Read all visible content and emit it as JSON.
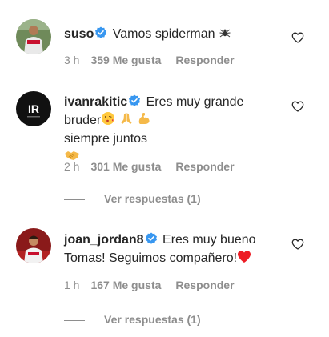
{
  "comments": [
    {
      "username": "suso",
      "text": "Vamos spiderman",
      "time": "3 h",
      "likes": "359 Me gusta",
      "reply": "Responder",
      "emoji": "spider-icon"
    },
    {
      "username": "ivanrakitic",
      "text": "Eres muy grande bruder",
      "text2": "siempre juntos",
      "time": "2 h",
      "likes": "301 Me gusta",
      "reply": "Responder",
      "view_replies": "Ver respuestas (1)",
      "avatar_text": "IR",
      "emojis": [
        "kiss-face-icon",
        "praying-hands-icon",
        "flexed-biceps-icon",
        "handshake-icon"
      ]
    },
    {
      "username": "joan_jordan8",
      "text": "Eres muy bueno Tomas! Seguimos compañero!",
      "time": "1 h",
      "likes": "167 Me gusta",
      "reply": "Responder",
      "view_replies": "Ver respuestas (1)",
      "emoji": "red-heart-icon"
    }
  ],
  "colors": {
    "text": "#262626",
    "secondary": "#8e8e8e",
    "verified": "#3897f0",
    "heart": "#ed1c24"
  }
}
